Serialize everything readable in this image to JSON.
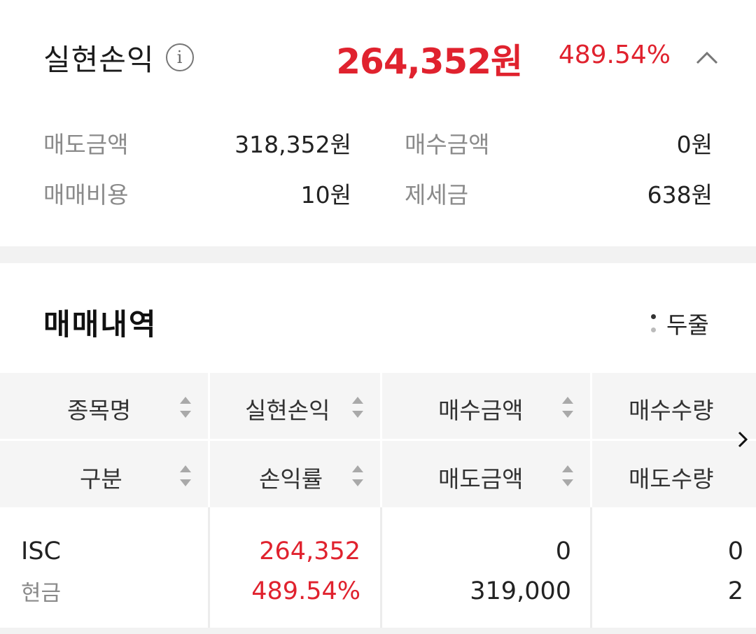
{
  "summary": {
    "title": "실현손익",
    "info_icon": "info-icon",
    "total_amount": "264,352원",
    "total_rate": "489.54%",
    "collapse_icon": "chevron-up-icon",
    "items": [
      {
        "label": "매도금액",
        "value": "318,352원"
      },
      {
        "label": "매수금액",
        "value": "0원"
      },
      {
        "label": "매매비용",
        "value": "10원"
      },
      {
        "label": "제세금",
        "value": "638원"
      }
    ]
  },
  "trades": {
    "title": "매매내역",
    "toggle_label": "두줄",
    "columns_top": [
      "종목명",
      "실현손익",
      "매수금액",
      "매수수량"
    ],
    "columns_bottom": [
      "구분",
      "손익률",
      "매도금액",
      "매도수량"
    ],
    "rows": [
      {
        "name": "ISC",
        "type": "현금",
        "profit": "264,352",
        "rate": "489.54%",
        "buy_amount": "0",
        "sell_amount": "319,000",
        "buy_qty": "0",
        "sell_qty": "2"
      }
    ]
  },
  "colors": {
    "profit_red": "#e0222e",
    "label_gray": "#8a8a8a",
    "header_bg": "#f5f5f5"
  }
}
